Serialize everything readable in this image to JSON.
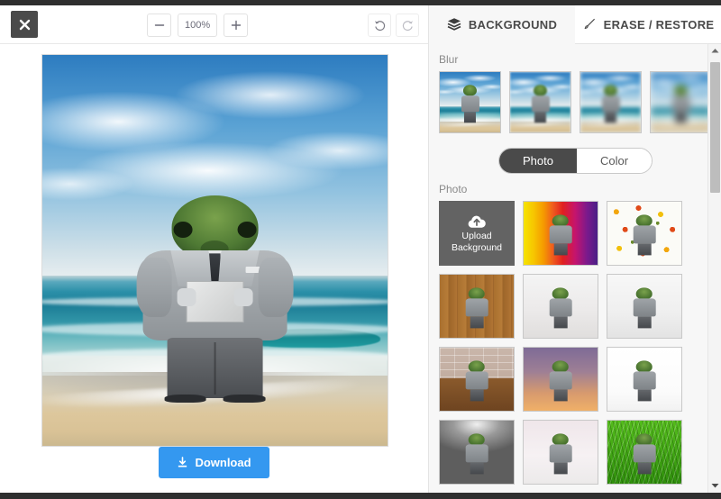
{
  "editor": {
    "close_label": "×",
    "close_icon": "close-icon",
    "zoom": {
      "minus_label": "−",
      "level": "100%",
      "plus_label": "+"
    },
    "history": {
      "undo_icon": "undo-icon",
      "redo_icon": "redo-icon"
    },
    "download": {
      "label": "Download",
      "icon": "download-icon",
      "color": "#3498f0"
    },
    "artwork": {
      "description": "Surreal composite: suited figure with a green frog head holding a paper, standing on a beach with ocean waves and cloudy blue sky"
    }
  },
  "panel": {
    "tabs": [
      {
        "label": "BACKGROUND",
        "icon": "layers-icon",
        "active": true
      },
      {
        "label": "ERASE / RESTORE",
        "icon": "brush-icon",
        "active": false
      }
    ],
    "blur": {
      "label": "Blur",
      "items": [
        {
          "name": "blur-none",
          "level": 0
        },
        {
          "name": "blur-low",
          "level": 1
        },
        {
          "name": "blur-medium",
          "level": 2
        },
        {
          "name": "blur-high",
          "level": 3
        }
      ]
    },
    "mode_toggle": {
      "options": [
        "Photo",
        "Color"
      ],
      "selected": "Photo"
    },
    "photo": {
      "label": "Photo",
      "upload": {
        "line1": "Upload",
        "line2": "Background",
        "icon": "cloud-upload-icon"
      },
      "items": [
        {
          "name": "bg-rainbow-stripes"
        },
        {
          "name": "bg-floral-pattern"
        },
        {
          "name": "bg-wood-planks"
        },
        {
          "name": "bg-studio-grey"
        },
        {
          "name": "bg-studio-light"
        },
        {
          "name": "bg-brick-wall-wood-floor"
        },
        {
          "name": "bg-sunset-gradient"
        },
        {
          "name": "bg-white-room"
        },
        {
          "name": "bg-spotlight-grey"
        },
        {
          "name": "bg-pale-interior"
        },
        {
          "name": "bg-green-grass"
        }
      ]
    },
    "scrollbar": {
      "up_arrow": "▲",
      "down_arrow": "▼"
    }
  }
}
